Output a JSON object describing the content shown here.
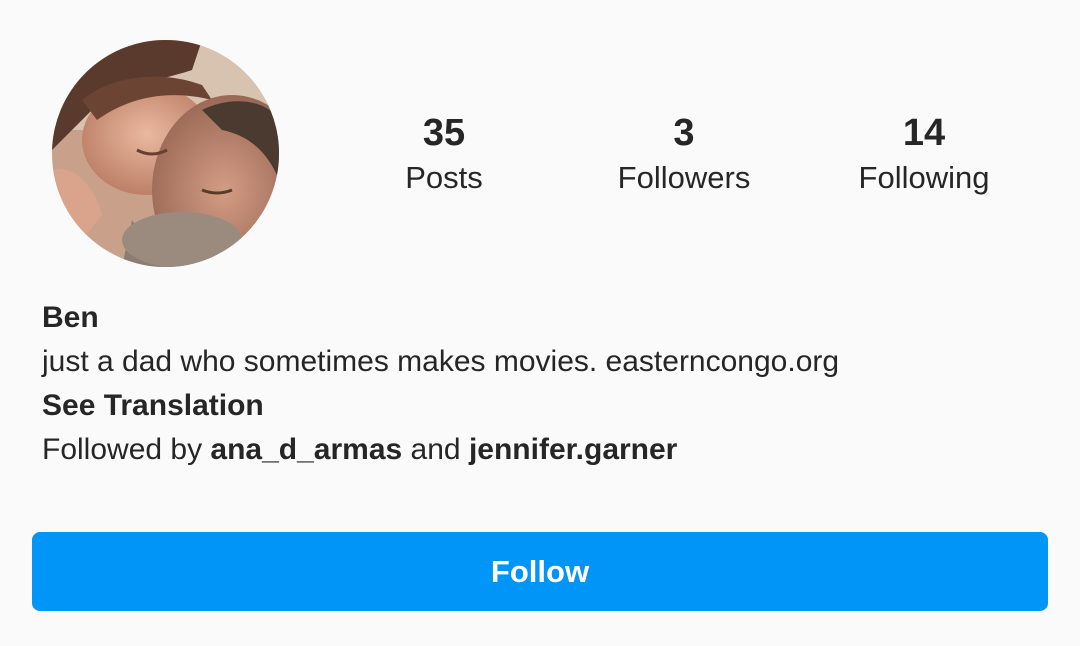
{
  "profile": {
    "avatar_icon": "profile-photo-avatar",
    "stats": {
      "posts": {
        "count": "35",
        "label": "Posts"
      },
      "followers": {
        "count": "3",
        "label": "Followers"
      },
      "following": {
        "count": "14",
        "label": "Following"
      }
    },
    "name": "Ben",
    "bio": "just a dad who sometimes makes movies. easterncongo.org",
    "see_translation": "See Translation",
    "followed_by": {
      "prefix": "Followed by ",
      "user1": "ana_d_armas",
      "conjunction": " and ",
      "user2": "jennifer.garner"
    },
    "follow_button": "Follow"
  },
  "colors": {
    "background": "#fafafa",
    "text": "#262626",
    "follow_button": "#0095f6",
    "follow_button_text": "#ffffff"
  }
}
